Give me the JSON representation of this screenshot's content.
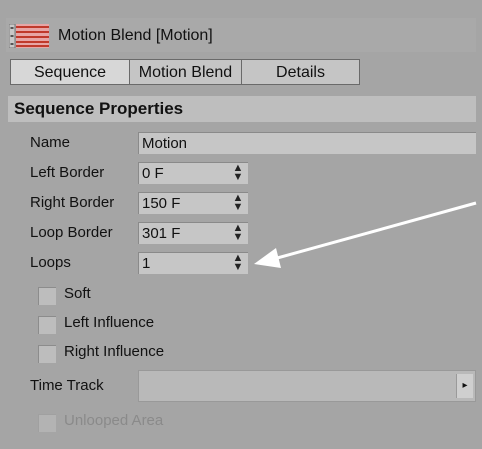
{
  "window": {
    "title": "Motion Blend [Motion]",
    "icon": "motion-blend-icon"
  },
  "tabs": [
    {
      "label": "Sequence",
      "active": true
    },
    {
      "label": "Motion Blend",
      "active": false
    },
    {
      "label": "Details",
      "active": false
    }
  ],
  "section": {
    "title": "Sequence Properties"
  },
  "fields": {
    "name": {
      "label": "Name",
      "value": "Motion"
    },
    "left_border": {
      "label": "Left Border",
      "value": "0 F"
    },
    "right_border": {
      "label": "Right Border",
      "value": "150 F"
    },
    "loop_border": {
      "label": "Loop Border",
      "value": "301 F"
    },
    "loops": {
      "label": "Loops",
      "value": "1"
    }
  },
  "checkboxes": {
    "soft": {
      "label": "Soft",
      "checked": false
    },
    "left_influence": {
      "label": "Left Influence",
      "checked": false
    },
    "right_influence": {
      "label": "Right Influence",
      "checked": false
    },
    "unlooped_area": {
      "label": "Unlooped Area",
      "checked": false,
      "disabled": true
    }
  },
  "time_track": {
    "label": "Time Track",
    "value": ""
  },
  "annotation": {
    "arrow_color": "#ffffff"
  },
  "colors": {
    "panel_bg": "#a5a5a5",
    "field_bg": "#c6c6c6",
    "header_bg": "#bebebe",
    "icon_accent": "#c0392b"
  }
}
